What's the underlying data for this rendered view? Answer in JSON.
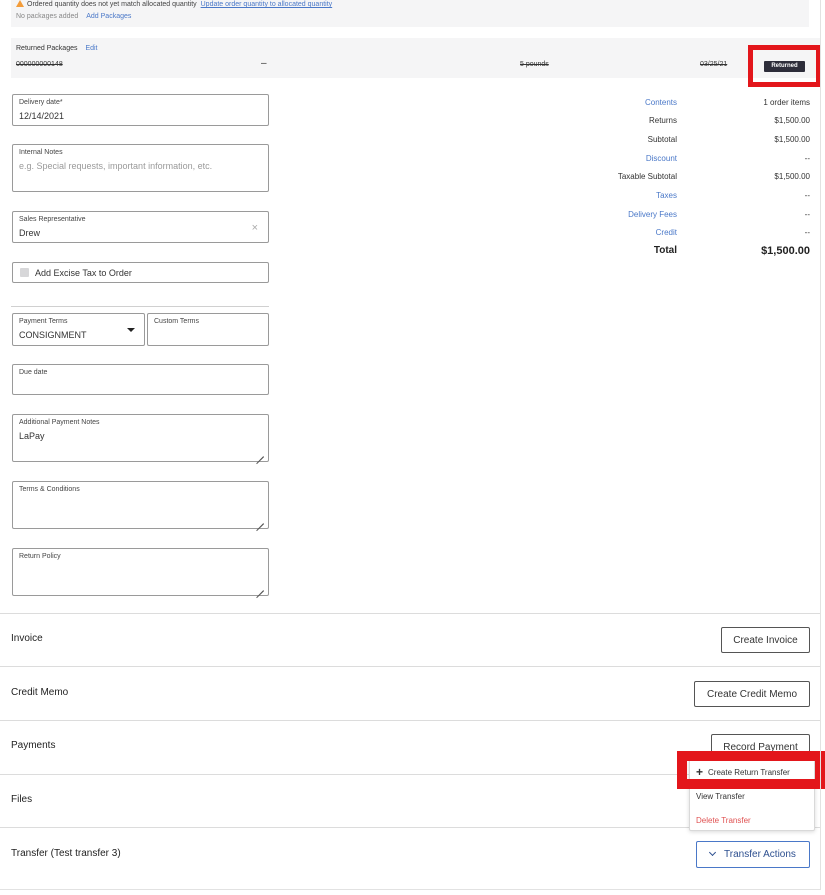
{
  "warning": {
    "message": "Ordered quantity does not yet match allocated quantity",
    "link": "Update order quantity to allocated quantity",
    "no_packages": "No packages added",
    "add_packages": "Add Packages"
  },
  "returned_packages": {
    "title": "Returned Packages",
    "edit_label": "Edit",
    "row": {
      "package_id": "000000000148",
      "dash": "–",
      "quantity": "5 pounds",
      "date": "03/25/21",
      "status": "Returned"
    }
  },
  "form": {
    "delivery_date": {
      "label": "Delivery date*",
      "value": "12/14/2021"
    },
    "internal_notes": {
      "label": "Internal Notes",
      "placeholder": "e.g. Special requests, important information, etc."
    },
    "sales_rep": {
      "label": "Sales Representative",
      "value": "Drew"
    },
    "excise_tax": {
      "label": "Add Excise Tax to Order"
    },
    "payment_terms": {
      "label": "Payment Terms",
      "value": "CONSIGNMENT"
    },
    "custom_terms": {
      "label": "Custom Terms",
      "value": ""
    },
    "due_date": {
      "label": "Due date",
      "value": ""
    },
    "additional_payment_notes": {
      "label": "Additional Payment Notes",
      "value": "LaPay"
    },
    "terms_conditions": {
      "label": "Terms & Conditions",
      "value": ""
    },
    "return_policy": {
      "label": "Return Policy",
      "value": ""
    }
  },
  "summary": [
    {
      "label": "Contents",
      "value": "1 order items",
      "link": true
    },
    {
      "label": "Returns",
      "value": "$1,500.00",
      "link": false
    },
    {
      "label": "Subtotal",
      "value": "$1,500.00",
      "link": false
    },
    {
      "label": "Discount",
      "value": "--",
      "link": true
    },
    {
      "label": "Taxable Subtotal",
      "value": "$1,500.00",
      "link": false
    },
    {
      "label": "Taxes",
      "value": "--",
      "link": true
    },
    {
      "label": "Delivery Fees",
      "value": "--",
      "link": true
    },
    {
      "label": "Credit",
      "value": "--",
      "link": true
    }
  ],
  "summary_total": {
    "label": "Total",
    "value": "$1,500.00"
  },
  "sections": {
    "invoice": {
      "title": "Invoice",
      "button": "Create Invoice"
    },
    "credit_memo": {
      "title": "Credit Memo",
      "button": "Create Credit Memo"
    },
    "payments": {
      "title": "Payments",
      "button": "Record Payment"
    },
    "files": {
      "title": "Files"
    },
    "transfer": {
      "title": "Transfer (Test transfer 3)",
      "button": "Transfer Actions"
    }
  },
  "transfer_menu": {
    "items": [
      "Create Return Transfer",
      "View Transfer",
      "Delete Transfer"
    ]
  },
  "colors": {
    "link": "#4a78c8",
    "highlight": "#e3161b",
    "danger": "#e05252",
    "badge": "#2d2d3a"
  }
}
